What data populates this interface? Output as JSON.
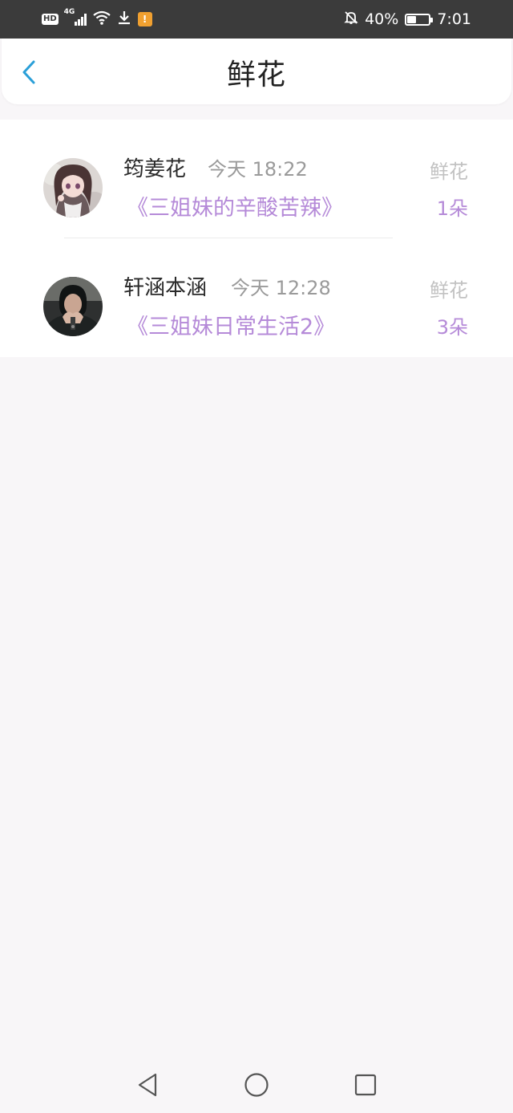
{
  "status_bar": {
    "network_type": "4G",
    "hd_label": "HD",
    "warning_badge": "!",
    "battery_text": "40%",
    "battery_level": 0.4,
    "time": "7:01"
  },
  "header": {
    "title": "鲜花",
    "back_icon": "chevron-left-icon",
    "accent_color": "#2a9fd8"
  },
  "list": {
    "items": [
      {
        "name": "筠姜花",
        "time": "今天 18:22",
        "book": "《三姐妹的辛酸苦辣》",
        "gift_label": "鲜花",
        "gift_count": "1朵"
      },
      {
        "name": "轩涵本涵",
        "time": "今天 12:28",
        "book": "《三姐妹日常生活2》",
        "gift_label": "鲜花",
        "gift_count": "3朵"
      }
    ]
  },
  "colors": {
    "highlight": "#b58ad8",
    "muted": "#9a9a9a",
    "background": "#f8f6f8"
  },
  "nav_bar": {
    "back_icon": "triangle-back-icon",
    "home_icon": "circle-home-icon",
    "recents_icon": "square-recents-icon"
  }
}
